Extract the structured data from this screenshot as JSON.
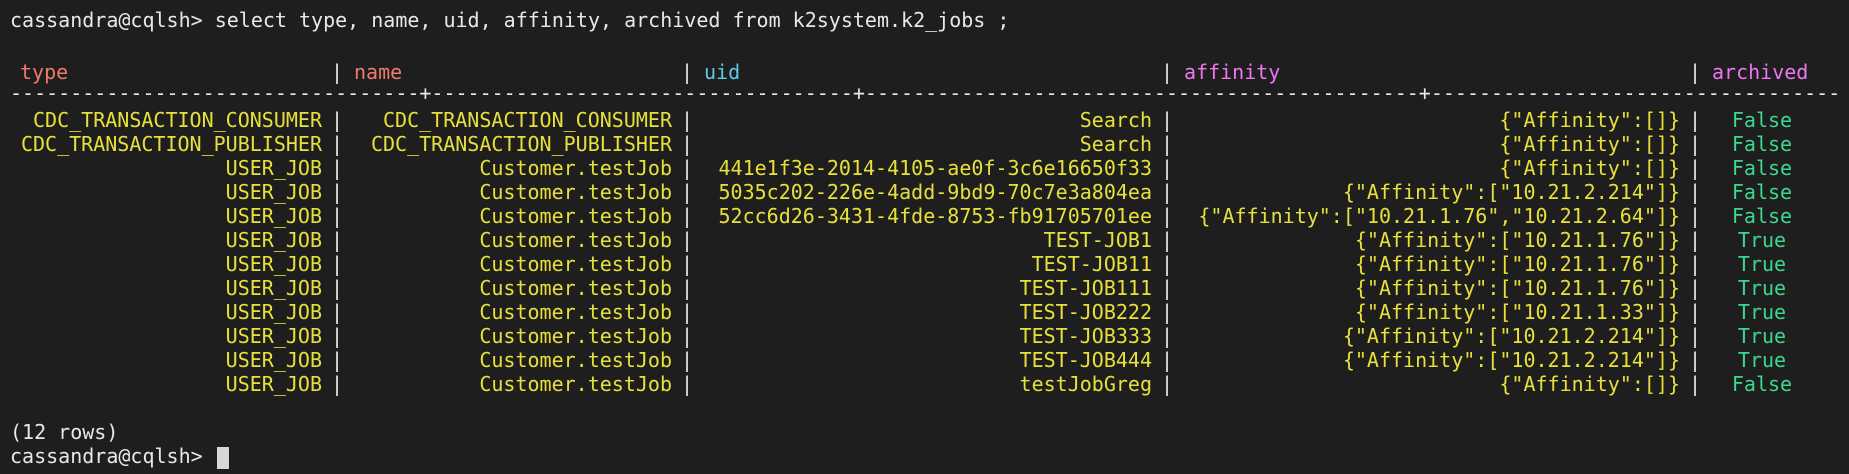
{
  "command": {
    "prompt": "cassandra@cqlsh>",
    "query": " select type, name, uid, affinity, archived from k2system.k2_jobs ;"
  },
  "table": {
    "headers": [
      "type",
      "name",
      "uid",
      "affinity",
      "archived"
    ],
    "divider": "----------------------------------+-----------------------------------+----------------------------------------------+-------------------------------------------------------+------------",
    "rows": [
      [
        "CDC_TRANSACTION_CONSUMER",
        "CDC_TRANSACTION_CONSUMER",
        "Search",
        "{\"Affinity\":[]}",
        "False"
      ],
      [
        "CDC_TRANSACTION_PUBLISHER",
        "CDC_TRANSACTION_PUBLISHER",
        "Search",
        "{\"Affinity\":[]}",
        "False"
      ],
      [
        "USER_JOB",
        "Customer.testJob",
        "441e1f3e-2014-4105-ae0f-3c6e16650f33",
        "{\"Affinity\":[]}",
        "False"
      ],
      [
        "USER_JOB",
        "Customer.testJob",
        "5035c202-226e-4add-9bd9-70c7e3a804ea",
        "{\"Affinity\":[\"10.21.2.214\"]}",
        "False"
      ],
      [
        "USER_JOB",
        "Customer.testJob",
        "52cc6d26-3431-4fde-8753-fb91705701ee",
        "{\"Affinity\":[\"10.21.1.76\",\"10.21.2.64\"]}",
        "False"
      ],
      [
        "USER_JOB",
        "Customer.testJob",
        "TEST-JOB1",
        "{\"Affinity\":[\"10.21.1.76\"]}",
        "True"
      ],
      [
        "USER_JOB",
        "Customer.testJob",
        "TEST-JOB11",
        "{\"Affinity\":[\"10.21.1.76\"]}",
        "True"
      ],
      [
        "USER_JOB",
        "Customer.testJob",
        "TEST-JOB111",
        "{\"Affinity\":[\"10.21.1.76\"]}",
        "True"
      ],
      [
        "USER_JOB",
        "Customer.testJob",
        "TEST-JOB222",
        "{\"Affinity\":[\"10.21.1.33\"]}",
        "True"
      ],
      [
        "USER_JOB",
        "Customer.testJob",
        "TEST-JOB333",
        "{\"Affinity\":[\"10.21.2.214\"]}",
        "True"
      ],
      [
        "USER_JOB",
        "Customer.testJob",
        "TEST-JOB444",
        "{\"Affinity\":[\"10.21.2.214\"]}",
        "True"
      ],
      [
        "USER_JOB",
        "Customer.testJob",
        "testJobGreg",
        "{\"Affinity\":[]}",
        "False"
      ]
    ]
  },
  "footer": {
    "row_count": "(12 rows)",
    "prompt": "cassandra@cqlsh>"
  },
  "colors": {
    "background": "#1e1e1e",
    "data_text": "#e8e03a",
    "bool_text": "#3cd890",
    "header_type": "#f07a6a",
    "header_uid": "#5fc8e8",
    "header_affinity": "#f075f0"
  }
}
